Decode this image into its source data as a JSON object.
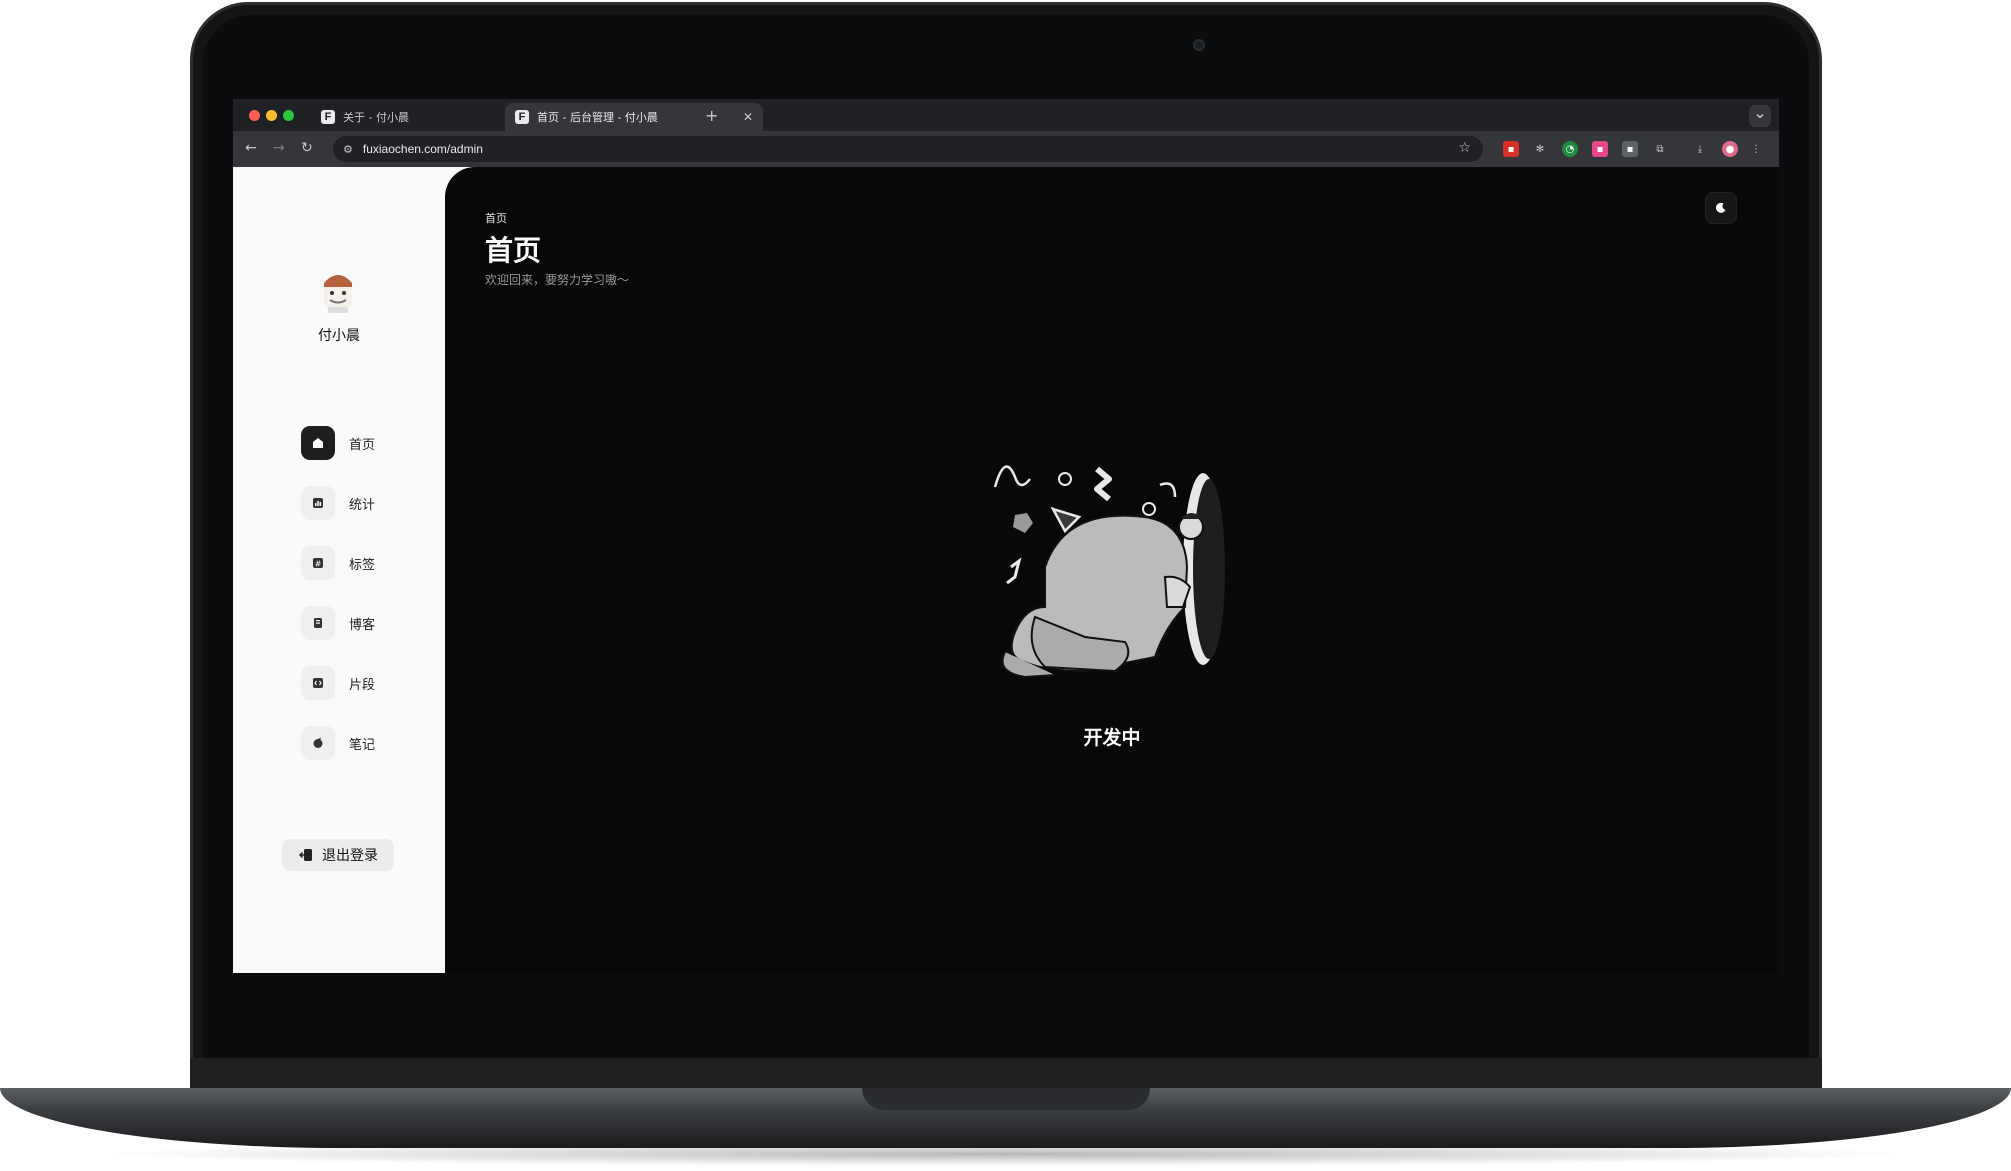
{
  "browser": {
    "tabs": [
      {
        "title": "关于 - 付小晨",
        "favicon": "F",
        "active": false
      },
      {
        "title": "首页 - 后台管理 - 付小晨",
        "favicon": "F",
        "active": true
      }
    ],
    "new_tab_label": "+",
    "url": "fuxiaochen.com/admin"
  },
  "sidebar": {
    "username": "付小晨",
    "items": [
      {
        "label": "首页",
        "icon": "home-icon",
        "active": true
      },
      {
        "label": "统计",
        "icon": "bar-chart-icon",
        "active": false
      },
      {
        "label": "标签",
        "icon": "hash-icon",
        "active": false
      },
      {
        "label": "博客",
        "icon": "book-icon",
        "active": false
      },
      {
        "label": "片段",
        "icon": "code-icon",
        "active": false
      },
      {
        "label": "笔记",
        "icon": "note-icon",
        "active": false
      }
    ],
    "logout_label": "退出登录"
  },
  "main": {
    "breadcrumb": "首页",
    "title": "首页",
    "subtitle": "欢迎回来，要努力学习嗷～",
    "status_text": "开发中"
  },
  "colors": {
    "sidebar_bg": "#fafafa",
    "main_bg": "#080808",
    "active_nav_bg": "#1e1e1e"
  }
}
